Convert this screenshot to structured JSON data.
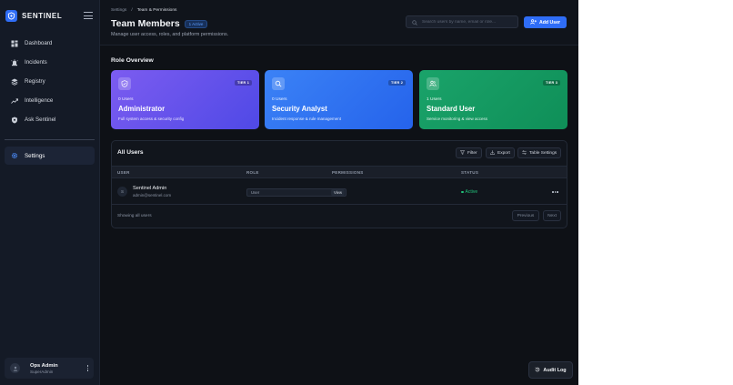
{
  "app": {
    "name": "SENTINEL",
    "brand_color": "#2f6df6"
  },
  "sidebar": {
    "items": [
      {
        "label": "Dashboard",
        "icon": "dashboard-icon"
      },
      {
        "label": "Incidents",
        "icon": "alarm-icon"
      },
      {
        "label": "Registry",
        "icon": "layers-icon"
      },
      {
        "label": "Intelligence",
        "icon": "trend-icon"
      },
      {
        "label": "Ask Sentinel",
        "icon": "shield-chat-icon"
      }
    ],
    "active_item": {
      "label": "Settings",
      "icon": "gear-icon"
    },
    "user": {
      "name": "Ops Admin",
      "role": "SuperAdmin"
    }
  },
  "header": {
    "breadcrumb": [
      "Settings",
      "Team & Permissions"
    ],
    "title": "Team Members",
    "badge": "1 Active",
    "subtitle": "Manage user access, roles, and platform permissions.",
    "search_placeholder": "Search users by name, email or role...",
    "add_button": "Add User"
  },
  "roles": {
    "section_title": "Role Overview",
    "cards": [
      {
        "tier": "TIER 1",
        "count": "0 Users",
        "name": "Administrator",
        "description": "Full system access & security config",
        "color": "#5b4fe9"
      },
      {
        "tier": "TIER 2",
        "count": "0 Users",
        "name": "Security Analyst",
        "description": "Incident response & rule management",
        "color": "#2f73f2"
      },
      {
        "tier": "TIER 3",
        "count": "1 Users",
        "name": "Standard User",
        "description": "Service monitoring & view access",
        "color": "#14995f"
      }
    ]
  },
  "users": {
    "title": "All Users",
    "filter": "Filter",
    "export": "Export",
    "table_settings": "Table Settings",
    "columns": [
      "USER",
      "ROLE",
      "PERMISSIONS",
      "STATUS"
    ],
    "rows": [
      {
        "initial": "S",
        "name": "Sentinel Admin",
        "email": "admin@sentinel.com",
        "permission": "User",
        "view": "View",
        "status": "Active",
        "status_color": "#22c27a"
      }
    ],
    "footer": "Showing all users",
    "previous": "Previous",
    "next": "Next"
  },
  "audit_log": "Audit Log"
}
